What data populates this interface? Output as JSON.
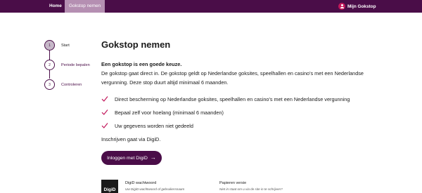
{
  "nav": {
    "home": "Home",
    "gokstop": "Gokstop nemen",
    "mijn": "Mijn Gokstop",
    "user_icon": "user-circle-icon"
  },
  "steps": [
    {
      "number": "1",
      "label": "Start",
      "active": true
    },
    {
      "number": "2",
      "label": "Periode bepalen",
      "active": false
    },
    {
      "number": "3",
      "label": "Controleren",
      "active": false
    }
  ],
  "main": {
    "title": "Gokstop nemen",
    "intro_bold": "Een gokstop is een goede keuze.",
    "intro_text": "De gokstop gaat direct in. De gokstop geldt op Nederlandse goksites, speelhallen en casino's met een Nederlandse vergunning. Deze stop duurt altijd minimaal 6 maanden.",
    "checks": [
      "Direct bescherming op Nederlandse goksites, speelhallen en casino's met een Nederlandse vergunning",
      "Bepaal zelf voor hoelang (minimaal 6 maanden)",
      "Uw gegevens worden niet gedeeld"
    ],
    "digid_note": "Inschrijven gaat via DigiD.",
    "login_button": "Inloggen met DigiD",
    "login_arrow": "→"
  },
  "footer": {
    "logo_text": "DigiD",
    "digid_title": "DigiD wachtwoord",
    "digid_sub": "Uw DigiD wachtwoord of gebruikersnaam",
    "paper_title": "Papieren versie",
    "paper_sub": "Niet in staat om u via de site in te schrijven?"
  },
  "colors": {
    "brand": "#4a0d48",
    "nav_active": "#b58fb2",
    "check": "#c2185b"
  }
}
